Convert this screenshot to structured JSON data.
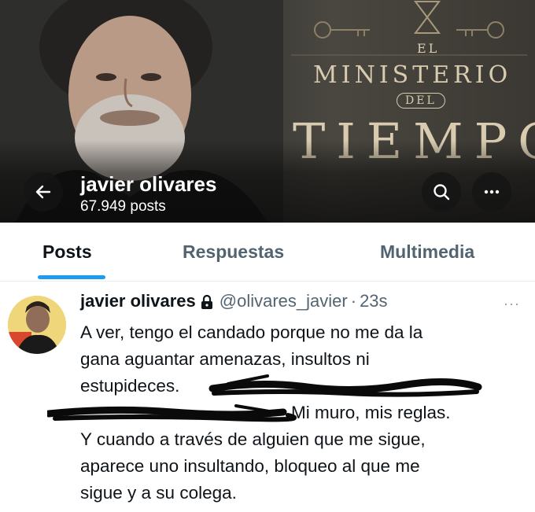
{
  "banner": {
    "show_el": "EL",
    "show_ministerio": "MINISTERIO",
    "show_del": "DEL",
    "show_tiempo": "TIEMPO"
  },
  "header": {
    "name": "javier olivares",
    "post_count": "67.949 posts",
    "back_icon": "arrow-left-icon",
    "search_icon": "search-icon",
    "more_icon": "more-horizontal-icon"
  },
  "tabs": [
    {
      "label": "Posts",
      "active": true
    },
    {
      "label": "Respuestas",
      "active": false
    },
    {
      "label": "Multimedia",
      "active": false
    }
  ],
  "tweet": {
    "author_name": "javier olivares",
    "handle": "@olivares_javier",
    "separator": "·",
    "time": "23s",
    "more": "···",
    "text_line1": "A ver, tengo el candado porque no me da la",
    "text_line2": "gana aguantar amenazas, insultos ni",
    "text_line3": "estupideces.",
    "text_line4": "Mi muro, mis reglas.",
    "text_line5": "Y cuando a través de alguien que me sigue,",
    "text_line6": "aparece uno insultando, bloqueo al que me",
    "text_line7": "sigue y a su colega."
  },
  "colors": {
    "accent": "#1d9bf0",
    "text_primary": "#0f1419",
    "text_secondary": "#536471",
    "banner_title": "#d8cbb0"
  }
}
